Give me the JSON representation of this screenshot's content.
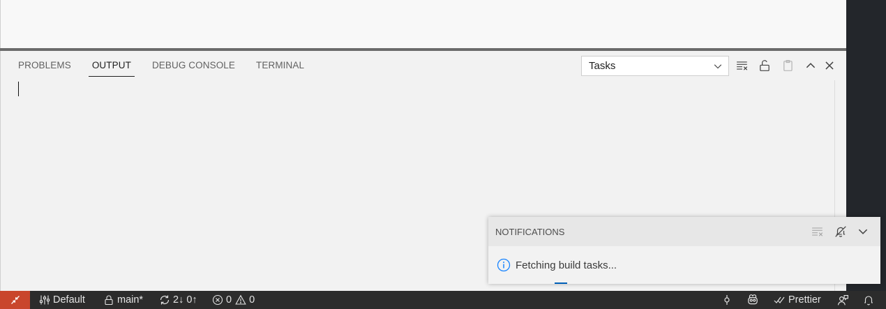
{
  "panel": {
    "tabs": [
      {
        "label": "PROBLEMS",
        "active": false
      },
      {
        "label": "OUTPUT",
        "active": true
      },
      {
        "label": "DEBUG CONSOLE",
        "active": false
      },
      {
        "label": "TERMINAL",
        "active": false
      }
    ],
    "channel_select": {
      "value": "Tasks"
    },
    "actions": [
      "clear-output-icon",
      "lock-scroll-icon",
      "open-in-editor-icon",
      "maximize-panel-icon",
      "close-panel-icon"
    ]
  },
  "notifications": {
    "header": "NOTIFICATIONS",
    "message": "Fetching build tasks...",
    "actions": [
      "clear-all-icon",
      "do-not-disturb-icon",
      "collapse-icon"
    ]
  },
  "statusbar": {
    "profile": "Default",
    "branch": "main*",
    "sync": "2↓ 0↑",
    "errors": "0",
    "warnings": "0",
    "formatter": "Prettier",
    "colors": {
      "background": "#2c2c2c",
      "remote": "#c9462c"
    }
  }
}
